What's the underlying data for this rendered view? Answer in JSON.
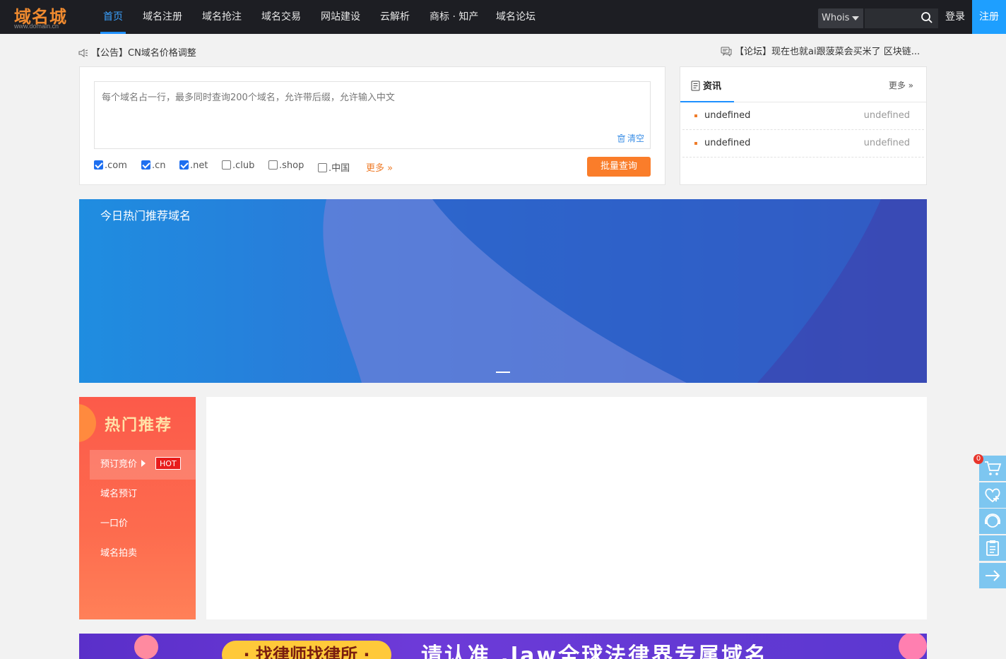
{
  "header": {
    "logo_cn": "域名城",
    "logo_url": "www.domain.cn",
    "nav": [
      {
        "label": "首页",
        "active": true
      },
      {
        "label": "域名注册"
      },
      {
        "label": "域名抢注"
      },
      {
        "label": "域名交易"
      },
      {
        "label": "网站建设"
      },
      {
        "label": "云解析"
      },
      {
        "label": "商标 · 知产"
      },
      {
        "label": "域名论坛"
      }
    ],
    "whois_label": "Whois",
    "login": "登录",
    "register": "注册"
  },
  "notices": {
    "left": "【公告】CN域名价格调整",
    "right": "【论坛】现在也就ai跟菠菜会买米了 区块链..."
  },
  "query": {
    "placeholder": "每个域名占一行，最多同时查询200个域名，允许带后缀，允许输入中文",
    "clear": "清空",
    "tlds": [
      {
        "label": ".com",
        "checked": true
      },
      {
        "label": ".cn",
        "checked": true
      },
      {
        "label": ".net",
        "checked": true
      },
      {
        "label": ".club",
        "checked": false
      },
      {
        "label": ".shop",
        "checked": false
      },
      {
        "label": ".中国",
        "checked": false
      }
    ],
    "more": "更多",
    "submit": "批量查询"
  },
  "news": {
    "title": "资讯",
    "more": "更多",
    "items": [
      {
        "title": "undefined",
        "date": "undefined"
      },
      {
        "title": "undefined",
        "date": "undefined"
      }
    ]
  },
  "banner": {
    "title": "今日热门推荐域名"
  },
  "hot": {
    "title": "热门推荐",
    "menu": [
      {
        "label": "预订竞价",
        "badge": "HOT",
        "active": true
      },
      {
        "label": "域名预订"
      },
      {
        "label": "一口价"
      },
      {
        "label": "域名拍卖"
      }
    ]
  },
  "ad": {
    "pill": "· 找律师找律所 ·",
    "text": "请认准 .law全球法律界专属域名"
  },
  "side_toolbar": {
    "cart_count": "0",
    "icons": [
      "cart-icon",
      "favorite-icon",
      "support-icon",
      "clipboard-icon",
      "arrow-right-icon"
    ]
  },
  "colors": {
    "nav_bg": "#1d1e23",
    "accent_blue": "#1e9fff",
    "accent_orange": "#fa7d2a",
    "hot_red": "#fc5a4a"
  }
}
